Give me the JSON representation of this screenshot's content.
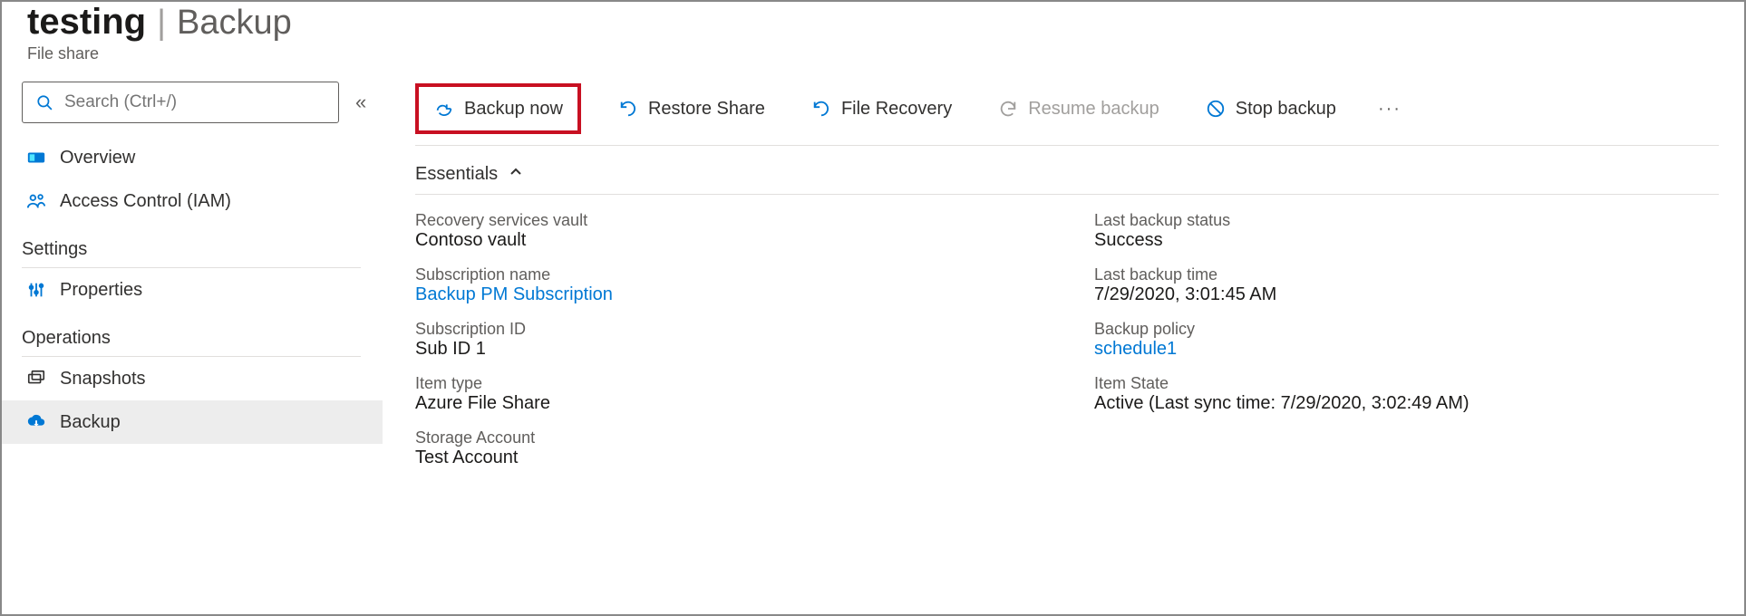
{
  "header": {
    "title_main": "testing",
    "title_sub": "Backup",
    "subtitle": "File share"
  },
  "sidebar": {
    "search_placeholder": "Search (Ctrl+/)",
    "items": [
      {
        "icon": "overview-icon",
        "label": "Overview"
      },
      {
        "icon": "access-icon",
        "label": "Access Control (IAM)"
      }
    ],
    "section_settings": "Settings",
    "settings_items": [
      {
        "icon": "properties-icon",
        "label": "Properties"
      }
    ],
    "section_operations": "Operations",
    "operations_items": [
      {
        "icon": "snapshots-icon",
        "label": "Snapshots"
      },
      {
        "icon": "backup-icon",
        "label": "Backup",
        "selected": true
      }
    ]
  },
  "toolbar": {
    "backup_now": "Backup now",
    "restore_share": "Restore Share",
    "file_recovery": "File Recovery",
    "resume_backup": "Resume backup",
    "stop_backup": "Stop backup"
  },
  "essentials": {
    "toggle_label": "Essentials",
    "left": {
      "recovery_vault_label": "Recovery services vault",
      "recovery_vault_value": "Contoso vault",
      "subscription_name_label": "Subscription name",
      "subscription_name_value": "Backup PM Subscription",
      "subscription_id_label": "Subscription ID",
      "subscription_id_value": "Sub ID 1",
      "item_type_label": "Item type",
      "item_type_value": "Azure File Share",
      "storage_account_label": "Storage Account",
      "storage_account_value": "Test Account"
    },
    "right": {
      "last_backup_status_label": "Last backup status",
      "last_backup_status_value": "Success",
      "last_backup_time_label": "Last backup time",
      "last_backup_time_value": "7/29/2020, 3:01:45 AM",
      "backup_policy_label": "Backup policy",
      "backup_policy_value": "schedule1",
      "item_state_label": "Item State",
      "item_state_value": "Active (Last sync time: 7/29/2020, 3:02:49 AM)"
    }
  }
}
